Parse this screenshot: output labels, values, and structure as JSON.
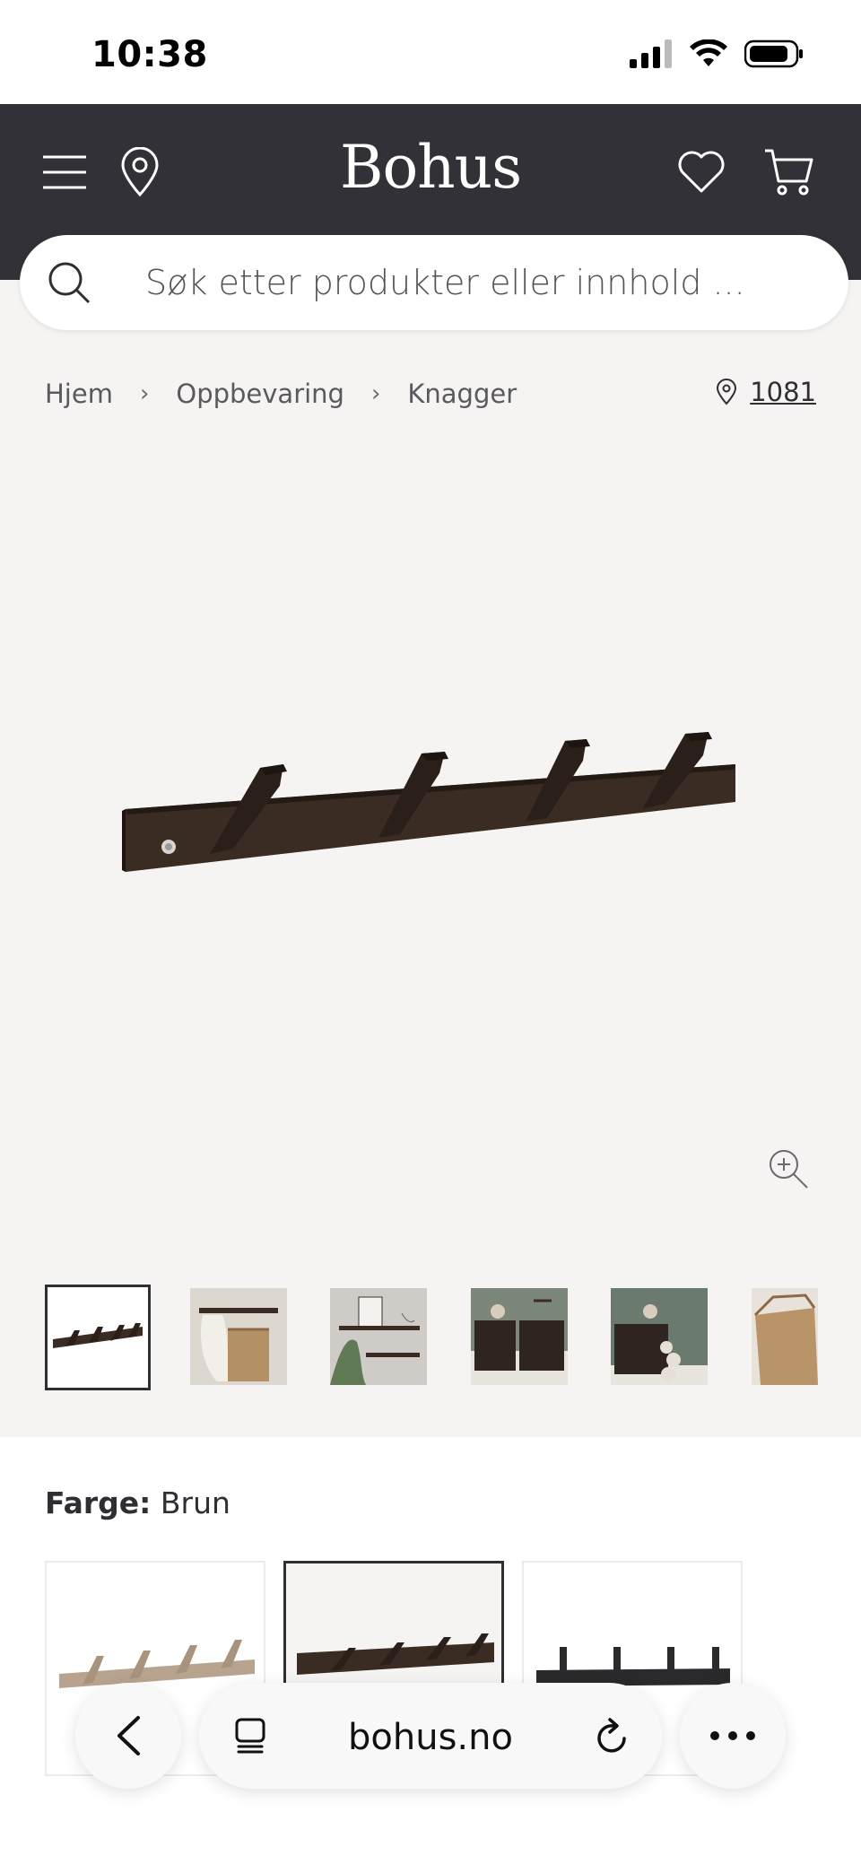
{
  "status": {
    "time": "10:38"
  },
  "header": {
    "logo": "Bohus"
  },
  "search": {
    "placeholder": "Søk etter produkter eller innhold ..."
  },
  "breadcrumb": {
    "items": [
      "Hjem",
      "Oppbevaring",
      "Knagger"
    ],
    "store": "1081"
  },
  "gallery": {
    "thumb_count": 6
  },
  "color": {
    "label": "Farge:",
    "value": "Brun"
  },
  "browser": {
    "url": "bohus.no"
  },
  "colors": {
    "header_bg": "#323137",
    "page_bg": "#f5f4f2",
    "text": "#2f2e33"
  }
}
